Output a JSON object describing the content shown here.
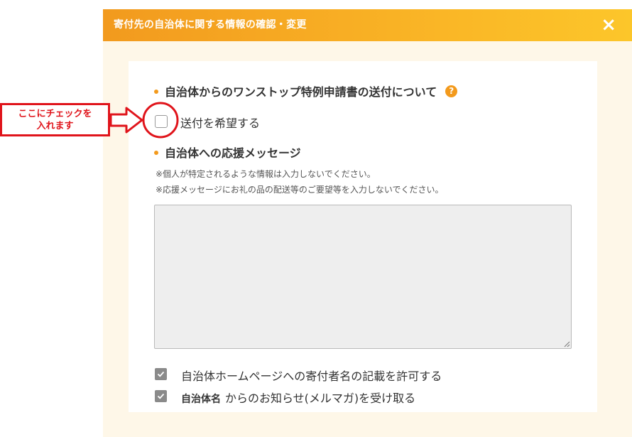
{
  "modal": {
    "title": "寄付先の自治体に関する情報の確認・変更",
    "close_icon": "×"
  },
  "onestop": {
    "heading": "自治体からのワンストップ特例申請書の送付について",
    "help_icon": "?",
    "checkbox_label": "送付を希望する",
    "checked": false
  },
  "message": {
    "heading": "自治体への応援メッセージ",
    "notes": [
      "※個人が特定されるような情報は入力しないでください。",
      "※応援メッセージにお礼の品の配送等のご要望等を入力しないでください。"
    ],
    "textarea_value": ""
  },
  "options": {
    "homepage_label": "自治体ホームページへの寄付者名の記載を許可する",
    "homepage_checked": true,
    "newsletter_bold": "自治体名",
    "newsletter_label": "からのお知らせ(メルマガ)を受け取る",
    "newsletter_checked": true
  },
  "annotation": {
    "lines": [
      "ここにチェックを",
      "入れます"
    ],
    "color": "#e0141b"
  },
  "colors": {
    "accent": "#f39a1c",
    "modal_bg": "#fef7e8",
    "annotation": "#e0141b"
  }
}
